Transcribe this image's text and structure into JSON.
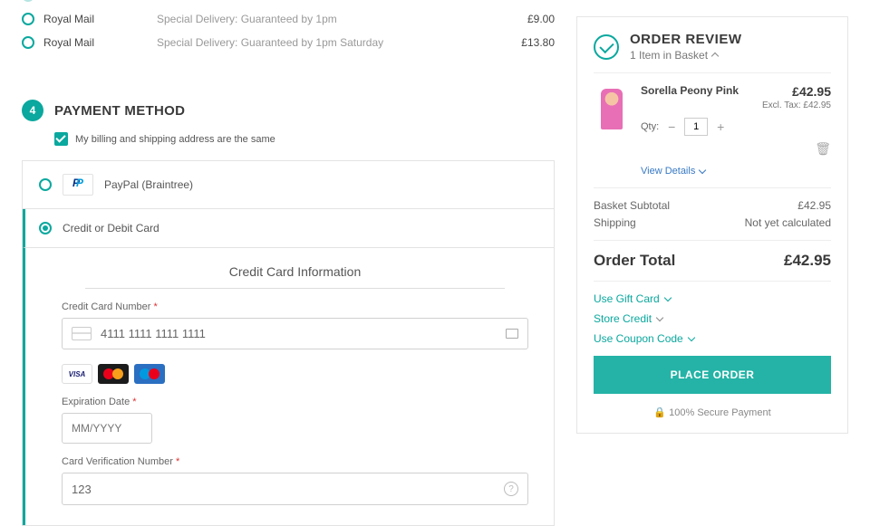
{
  "shipping": {
    "rows": [
      {
        "carrier": "Royal Mail",
        "method": "Special Delivery: Guaranteed by 1pm",
        "price": "£9.00"
      },
      {
        "carrier": "Royal Mail",
        "method": "Special Delivery: Guaranteed by 1pm Saturday",
        "price": "£13.80"
      }
    ]
  },
  "paymentSection": {
    "step": "4",
    "title": "PAYMENT METHOD",
    "sameAddressLabel": "My billing and shipping address are the same",
    "options": {
      "paypal": "PayPal (Braintree)",
      "card": "Credit or Debit Card"
    },
    "cc": {
      "heading": "Credit Card Information",
      "numberLabel": "Credit Card Number",
      "numberValue": "4111 1111 1111 1111",
      "expLabel": "Expiration Date",
      "expPlaceholder": "MM/YYYY",
      "cvvLabel": "Card Verification Number",
      "cvvValue": "123",
      "cards": {
        "visa": "VISA"
      }
    }
  },
  "review": {
    "title": "ORDER REVIEW",
    "subtitle": "1 Item in Basket",
    "item": {
      "name": "Sorella Peony Pink",
      "price": "£42.95",
      "exclLabel": "Excl. Tax: £42.95",
      "qtyLabel": "Qty:",
      "qty": "1",
      "viewDetails": "View Details"
    },
    "subtotalLabel": "Basket Subtotal",
    "subtotal": "£42.95",
    "shippingLabel": "Shipping",
    "shippingValue": "Not yet calculated",
    "totalLabel": "Order Total",
    "totalValue": "£42.95",
    "giftCard": "Use Gift Card",
    "storeCredit": "Store Credit",
    "coupon": "Use Coupon Code",
    "placeOrder": "PLACE ORDER",
    "secure": "100% Secure Payment"
  }
}
